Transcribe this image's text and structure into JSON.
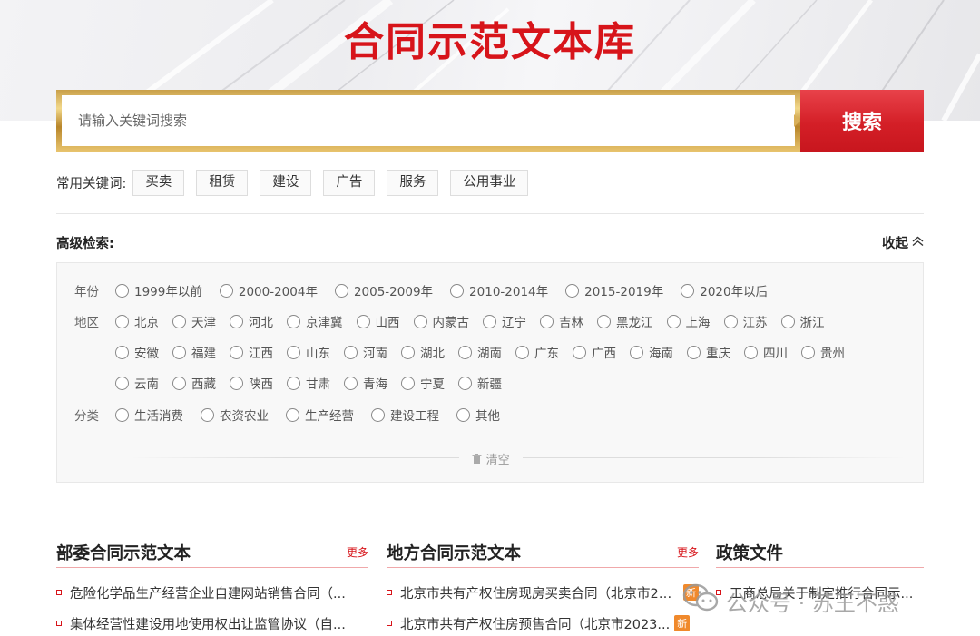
{
  "header": {
    "title": "合同示范文本库"
  },
  "search": {
    "placeholder": "请输入关键词搜索",
    "button_label": "搜索"
  },
  "keywords": {
    "label": "常用关键词:",
    "items": [
      "买卖",
      "租赁",
      "建设",
      "广告",
      "服务",
      "公用事业"
    ]
  },
  "advanced": {
    "title": "高级检索:",
    "collapse_label": "收起",
    "clear_label": "清空",
    "year": {
      "label": "年份",
      "options": [
        "1999年以前",
        "2000-2004年",
        "2005-2009年",
        "2010-2014年",
        "2015-2019年",
        "2020年以后"
      ]
    },
    "region": {
      "label": "地区",
      "row1": [
        "北京",
        "天津",
        "河北",
        "京津冀",
        "山西",
        "内蒙古",
        "辽宁",
        "吉林",
        "黑龙江",
        "上海",
        "江苏",
        "浙江"
      ],
      "row2": [
        "安徽",
        "福建",
        "江西",
        "山东",
        "河南",
        "湖北",
        "湖南",
        "广东",
        "广西",
        "海南",
        "重庆",
        "四川",
        "贵州"
      ],
      "row3": [
        "云南",
        "西藏",
        "陕西",
        "甘肃",
        "青海",
        "宁夏",
        "新疆"
      ]
    },
    "category": {
      "label": "分类",
      "options": [
        "生活消费",
        "农资农业",
        "生产经营",
        "建设工程",
        "其他"
      ]
    }
  },
  "columns": [
    {
      "title": "部委合同示范文本",
      "more": "更多",
      "items": [
        {
          "text": "危险化学品生产经营企业自建网站销售合同（...",
          "badge": ""
        },
        {
          "text": "集体经营性建设用地使用权出让监管协议（自...",
          "badge": ""
        }
      ]
    },
    {
      "title": "地方合同示范文本",
      "more": "更多",
      "items": [
        {
          "text": "北京市共有产权住房现房买卖合同（北京市20...",
          "badge": "新"
        },
        {
          "text": "北京市共有产权住房预售合同（北京市2023...",
          "badge": "新"
        }
      ]
    },
    {
      "title": "政策文件",
      "more": "",
      "items": [
        {
          "text": "工商总局关于制定推行合同示...",
          "badge": ""
        }
      ]
    }
  ],
  "watermark": {
    "text": "公众号 · 苏王不惑"
  },
  "colors": {
    "brand_red": "#d7141a",
    "gold": "#c9a04a",
    "badge_orange": "#f0892c"
  }
}
